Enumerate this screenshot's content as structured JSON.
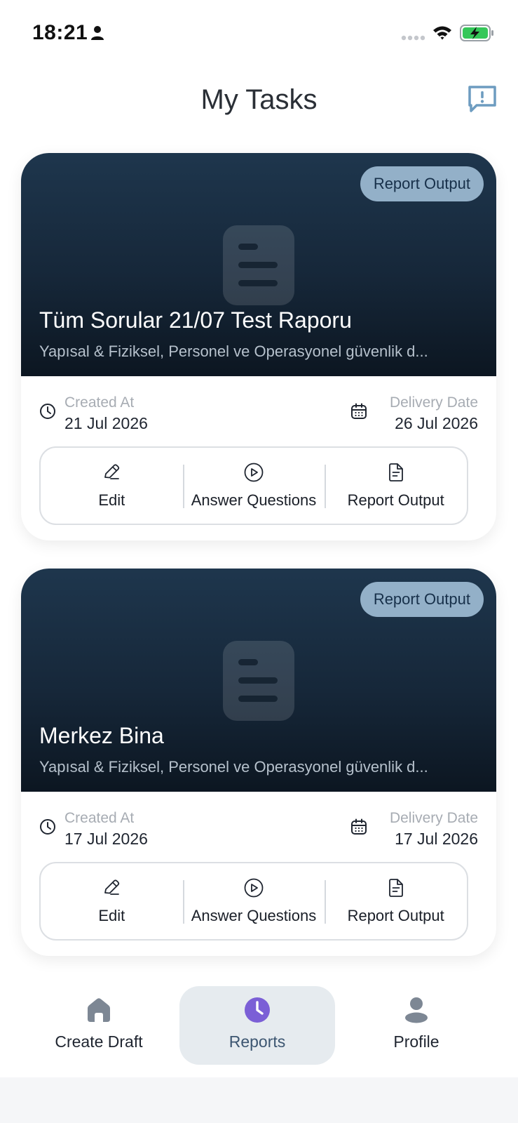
{
  "status_bar": {
    "time": "18:21"
  },
  "header": {
    "title": "My Tasks"
  },
  "tasks": [
    {
      "badge": "Report Output",
      "title": "Tüm Sorular 21/07 Test Raporu",
      "subtitle": "Yapısal & Fiziksel, Personel ve Operasyonel güvenlik d...",
      "created_label": "Created At",
      "created_value": "21 Jul 2026",
      "delivery_label": "Delivery Date",
      "delivery_value": "26 Jul 2026",
      "actions": {
        "edit": "Edit",
        "answer": "Answer Questions",
        "report": "Report Output"
      }
    },
    {
      "badge": "Report Output",
      "title": "Merkez Bina",
      "subtitle": "Yapısal & Fiziksel, Personel ve Operasyonel güvenlik d...",
      "created_label": "Created At",
      "created_value": "17 Jul 2026",
      "delivery_label": "Delivery Date",
      "delivery_value": "17 Jul 2026",
      "actions": {
        "edit": "Edit",
        "answer": "Answer Questions",
        "report": "Report Output"
      }
    }
  ],
  "bottom_nav": {
    "items": [
      {
        "label": "Create Draft",
        "icon": "home-icon"
      },
      {
        "label": "Reports",
        "icon": "clock-icon",
        "active": true
      },
      {
        "label": "Profile",
        "icon": "person-icon"
      }
    ]
  },
  "colors": {
    "accent": "#7b5fd6",
    "badge_bg": "#93b0c8",
    "feedback_icon": "#6d9cc0",
    "hero_top": "#1e364d",
    "hero_bottom": "#0c1621",
    "battery_green": "#35c759"
  }
}
